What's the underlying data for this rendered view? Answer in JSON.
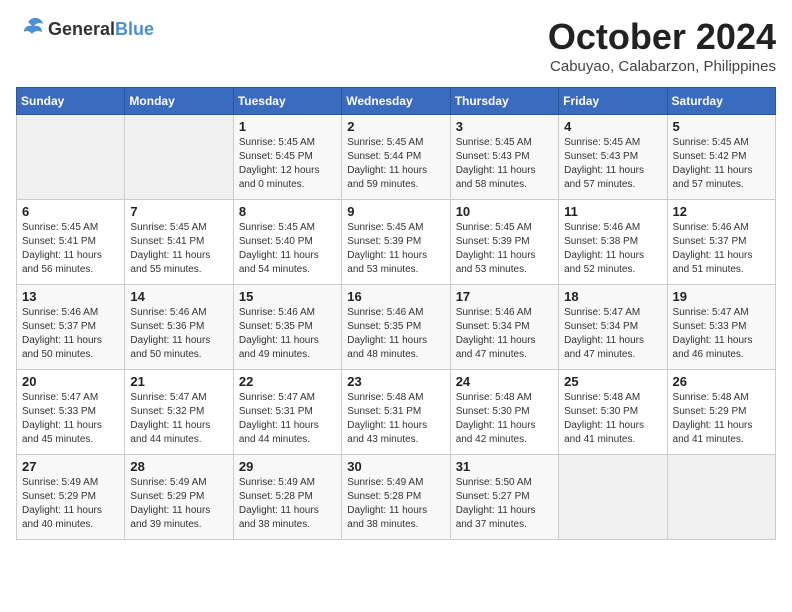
{
  "header": {
    "logo_general": "General",
    "logo_blue": "Blue",
    "month": "October 2024",
    "location": "Cabuyao, Calabarzon, Philippines"
  },
  "weekdays": [
    "Sunday",
    "Monday",
    "Tuesday",
    "Wednesday",
    "Thursday",
    "Friday",
    "Saturday"
  ],
  "weeks": [
    [
      {
        "day": "",
        "sunrise": "",
        "sunset": "",
        "daylight": ""
      },
      {
        "day": "",
        "sunrise": "",
        "sunset": "",
        "daylight": ""
      },
      {
        "day": "1",
        "sunrise": "Sunrise: 5:45 AM",
        "sunset": "Sunset: 5:45 PM",
        "daylight": "Daylight: 12 hours and 0 minutes."
      },
      {
        "day": "2",
        "sunrise": "Sunrise: 5:45 AM",
        "sunset": "Sunset: 5:44 PM",
        "daylight": "Daylight: 11 hours and 59 minutes."
      },
      {
        "day": "3",
        "sunrise": "Sunrise: 5:45 AM",
        "sunset": "Sunset: 5:43 PM",
        "daylight": "Daylight: 11 hours and 58 minutes."
      },
      {
        "day": "4",
        "sunrise": "Sunrise: 5:45 AM",
        "sunset": "Sunset: 5:43 PM",
        "daylight": "Daylight: 11 hours and 57 minutes."
      },
      {
        "day": "5",
        "sunrise": "Sunrise: 5:45 AM",
        "sunset": "Sunset: 5:42 PM",
        "daylight": "Daylight: 11 hours and 57 minutes."
      }
    ],
    [
      {
        "day": "6",
        "sunrise": "Sunrise: 5:45 AM",
        "sunset": "Sunset: 5:41 PM",
        "daylight": "Daylight: 11 hours and 56 minutes."
      },
      {
        "day": "7",
        "sunrise": "Sunrise: 5:45 AM",
        "sunset": "Sunset: 5:41 PM",
        "daylight": "Daylight: 11 hours and 55 minutes."
      },
      {
        "day": "8",
        "sunrise": "Sunrise: 5:45 AM",
        "sunset": "Sunset: 5:40 PM",
        "daylight": "Daylight: 11 hours and 54 minutes."
      },
      {
        "day": "9",
        "sunrise": "Sunrise: 5:45 AM",
        "sunset": "Sunset: 5:39 PM",
        "daylight": "Daylight: 11 hours and 53 minutes."
      },
      {
        "day": "10",
        "sunrise": "Sunrise: 5:45 AM",
        "sunset": "Sunset: 5:39 PM",
        "daylight": "Daylight: 11 hours and 53 minutes."
      },
      {
        "day": "11",
        "sunrise": "Sunrise: 5:46 AM",
        "sunset": "Sunset: 5:38 PM",
        "daylight": "Daylight: 11 hours and 52 minutes."
      },
      {
        "day": "12",
        "sunrise": "Sunrise: 5:46 AM",
        "sunset": "Sunset: 5:37 PM",
        "daylight": "Daylight: 11 hours and 51 minutes."
      }
    ],
    [
      {
        "day": "13",
        "sunrise": "Sunrise: 5:46 AM",
        "sunset": "Sunset: 5:37 PM",
        "daylight": "Daylight: 11 hours and 50 minutes."
      },
      {
        "day": "14",
        "sunrise": "Sunrise: 5:46 AM",
        "sunset": "Sunset: 5:36 PM",
        "daylight": "Daylight: 11 hours and 50 minutes."
      },
      {
        "day": "15",
        "sunrise": "Sunrise: 5:46 AM",
        "sunset": "Sunset: 5:35 PM",
        "daylight": "Daylight: 11 hours and 49 minutes."
      },
      {
        "day": "16",
        "sunrise": "Sunrise: 5:46 AM",
        "sunset": "Sunset: 5:35 PM",
        "daylight": "Daylight: 11 hours and 48 minutes."
      },
      {
        "day": "17",
        "sunrise": "Sunrise: 5:46 AM",
        "sunset": "Sunset: 5:34 PM",
        "daylight": "Daylight: 11 hours and 47 minutes."
      },
      {
        "day": "18",
        "sunrise": "Sunrise: 5:47 AM",
        "sunset": "Sunset: 5:34 PM",
        "daylight": "Daylight: 11 hours and 47 minutes."
      },
      {
        "day": "19",
        "sunrise": "Sunrise: 5:47 AM",
        "sunset": "Sunset: 5:33 PM",
        "daylight": "Daylight: 11 hours and 46 minutes."
      }
    ],
    [
      {
        "day": "20",
        "sunrise": "Sunrise: 5:47 AM",
        "sunset": "Sunset: 5:33 PM",
        "daylight": "Daylight: 11 hours and 45 minutes."
      },
      {
        "day": "21",
        "sunrise": "Sunrise: 5:47 AM",
        "sunset": "Sunset: 5:32 PM",
        "daylight": "Daylight: 11 hours and 44 minutes."
      },
      {
        "day": "22",
        "sunrise": "Sunrise: 5:47 AM",
        "sunset": "Sunset: 5:31 PM",
        "daylight": "Daylight: 11 hours and 44 minutes."
      },
      {
        "day": "23",
        "sunrise": "Sunrise: 5:48 AM",
        "sunset": "Sunset: 5:31 PM",
        "daylight": "Daylight: 11 hours and 43 minutes."
      },
      {
        "day": "24",
        "sunrise": "Sunrise: 5:48 AM",
        "sunset": "Sunset: 5:30 PM",
        "daylight": "Daylight: 11 hours and 42 minutes."
      },
      {
        "day": "25",
        "sunrise": "Sunrise: 5:48 AM",
        "sunset": "Sunset: 5:30 PM",
        "daylight": "Daylight: 11 hours and 41 minutes."
      },
      {
        "day": "26",
        "sunrise": "Sunrise: 5:48 AM",
        "sunset": "Sunset: 5:29 PM",
        "daylight": "Daylight: 11 hours and 41 minutes."
      }
    ],
    [
      {
        "day": "27",
        "sunrise": "Sunrise: 5:49 AM",
        "sunset": "Sunset: 5:29 PM",
        "daylight": "Daylight: 11 hours and 40 minutes."
      },
      {
        "day": "28",
        "sunrise": "Sunrise: 5:49 AM",
        "sunset": "Sunset: 5:29 PM",
        "daylight": "Daylight: 11 hours and 39 minutes."
      },
      {
        "day": "29",
        "sunrise": "Sunrise: 5:49 AM",
        "sunset": "Sunset: 5:28 PM",
        "daylight": "Daylight: 11 hours and 38 minutes."
      },
      {
        "day": "30",
        "sunrise": "Sunrise: 5:49 AM",
        "sunset": "Sunset: 5:28 PM",
        "daylight": "Daylight: 11 hours and 38 minutes."
      },
      {
        "day": "31",
        "sunrise": "Sunrise: 5:50 AM",
        "sunset": "Sunset: 5:27 PM",
        "daylight": "Daylight: 11 hours and 37 minutes."
      },
      {
        "day": "",
        "sunrise": "",
        "sunset": "",
        "daylight": ""
      },
      {
        "day": "",
        "sunrise": "",
        "sunset": "",
        "daylight": ""
      }
    ]
  ]
}
